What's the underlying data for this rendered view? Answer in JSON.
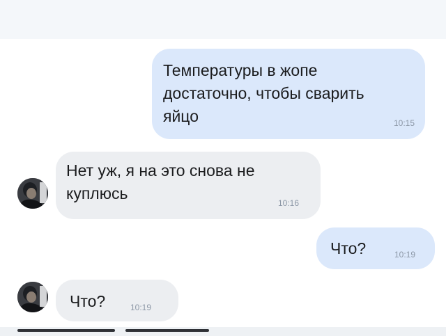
{
  "conversation": {
    "messages": [
      {
        "direction": "outgoing",
        "text": "Температуры в жопе\nдостаточно, чтобы сварить\nяйцо",
        "time": "10:15"
      },
      {
        "direction": "incoming",
        "text": "Нет уж, я на это снова не\nкуплюсь",
        "time": "10:16"
      },
      {
        "direction": "outgoing",
        "text": "Что?",
        "time": "10:19"
      },
      {
        "direction": "incoming",
        "text": "Что?",
        "time": "10:19"
      }
    ]
  },
  "colors": {
    "outgoing_bubble": "#dbe8fb",
    "incoming_bubble": "#eceef1",
    "timestamp": "#8c97a6"
  },
  "icons": {
    "avatar": "contact-avatar-photo"
  }
}
